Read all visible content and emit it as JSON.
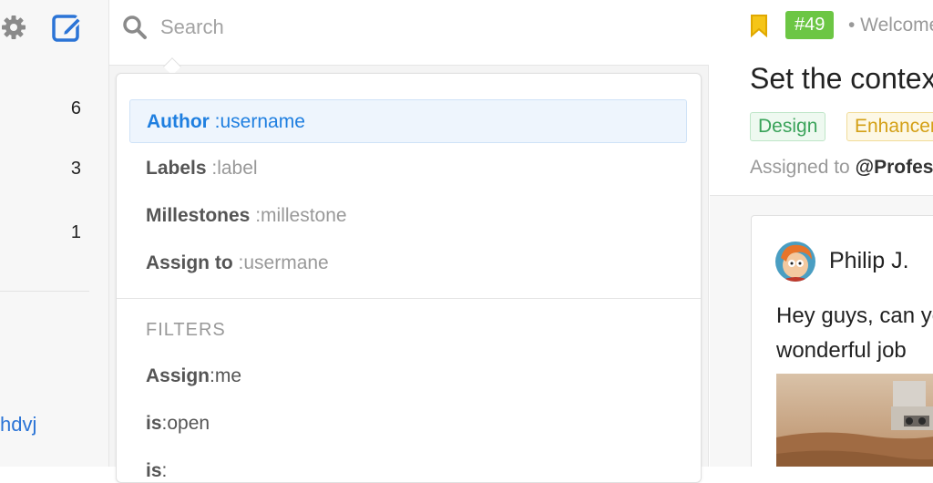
{
  "sidebar": {
    "counts": [
      "6",
      "3",
      "1"
    ],
    "link_text": "hdvj"
  },
  "search": {
    "placeholder": "Search",
    "suggestions": [
      {
        "key": "Author",
        "value": ":username"
      },
      {
        "key": "Labels",
        "value": ":label"
      },
      {
        "key": "Millestones",
        "value": ":millestone"
      },
      {
        "key": "Assign to",
        "value": ":usermane"
      }
    ],
    "filters_heading": "FILTERS",
    "filters": [
      {
        "key": "Assign",
        "value": ":me"
      },
      {
        "key": "is",
        "value": ":open"
      },
      {
        "key": "is",
        "value": ":"
      }
    ]
  },
  "issue": {
    "number": "#49",
    "breadcrumb": "• Welcome",
    "title": "Set the context",
    "labels": [
      "Design",
      "Enhancement"
    ],
    "assigned_prefix": "Assigned to",
    "assignee": "@Professor",
    "comment": {
      "author": "Philip J.",
      "lines": [
        "Hey guys, can you",
        "wonderful job"
      ]
    }
  },
  "colors": {
    "accent_blue": "#1f7fe0",
    "issue_green": "#6cc644",
    "bookmark_yellow": "#f5c518",
    "design_green": "#3aa35a",
    "enhancement_gold": "#d4a017"
  },
  "icons": {
    "settings": "gear-icon",
    "compose": "compose-icon",
    "search": "search-icon",
    "bookmark": "bookmark-icon"
  }
}
